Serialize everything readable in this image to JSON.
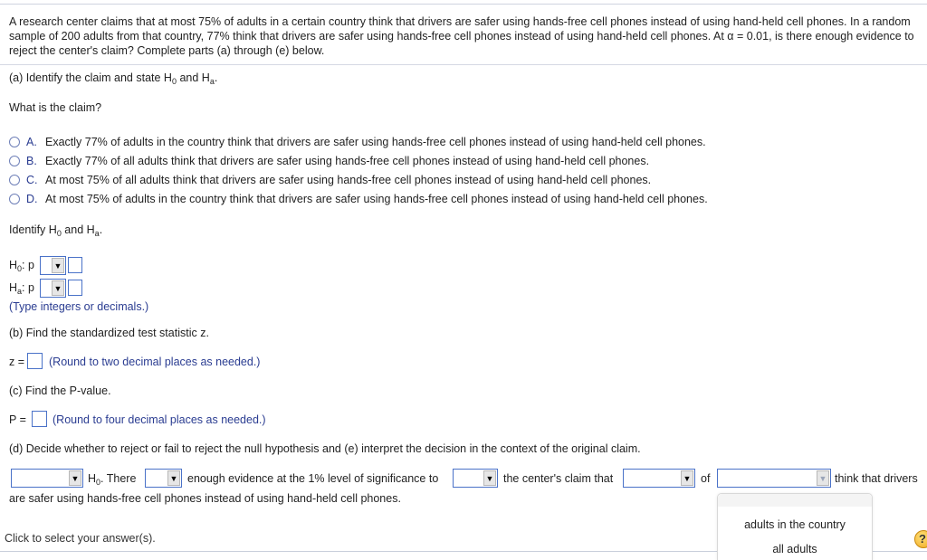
{
  "question": {
    "text": "A research center claims that at most 75% of adults in a certain country think that drivers are safer using hands-free cell phones instead of using hand-held cell phones. In a random sample of 200 adults from that country, 77% think that drivers are safer using hands-free cell phones instead of using hand-held cell phones. At α = 0.01, is there enough evidence to reject the center's claim? Complete parts (a) through (e) below."
  },
  "part_a": {
    "heading_prefix": "(a) Identify the claim and state H",
    "heading_sub0": "0",
    "heading_mid": " and H",
    "heading_suba": "a",
    "heading_end": ".",
    "claim_question": "What is the claim?",
    "options": [
      {
        "letter": "A.",
        "text": "Exactly 77% of adults in the country think that drivers are safer using hands-free cell phones instead of using hand-held cell phones."
      },
      {
        "letter": "B.",
        "text": "Exactly 77% of all adults think that drivers are safer using hands-free cell phones instead of using hand-held cell phones."
      },
      {
        "letter": "C.",
        "text": "At most 75% of all adults think that drivers are safer using hands-free cell phones instead of using hand-held cell phones."
      },
      {
        "letter": "D.",
        "text": "At most 75% of adults in the country think that drivers are safer using hands-free cell phones instead of using hand-held cell phones."
      }
    ],
    "identify_prefix": "Identify H",
    "identify_sub0": "0",
    "identify_mid": " and H",
    "identify_suba": "a",
    "identify_end": ".",
    "h0_label": "H",
    "h0_sub": "0",
    "h0_suffix": ": p",
    "ha_label": "H",
    "ha_sub": "a",
    "ha_suffix": ": p",
    "hint": "(Type integers or decimals.)"
  },
  "part_b": {
    "heading": "(b) Find the standardized test statistic z.",
    "label": "z =",
    "hint": "(Round to two decimal places as needed.)"
  },
  "part_c": {
    "heading": "(c) Find the P-value.",
    "label": "P =",
    "hint": "(Round to four decimal places as needed.)"
  },
  "part_d": {
    "heading": "(d) Decide whether to reject or fail to reject the null hypothesis and (e) interpret the decision in the context of the original claim.",
    "h_label": "H",
    "h_sub": "0",
    "after_h": ". There",
    "enough": "enough evidence at the 1% level of significance to",
    "center_claim": "the center's claim that",
    "of": "of",
    "think": "think that drivers",
    "continuation": "are safer using hands-free cell phones instead of using hand-held cell phones."
  },
  "dropdown_menu": {
    "items": [
      "adults in the country",
      "all adults"
    ]
  },
  "footer": {
    "status": "Click to select your answer(s).",
    "help_glyph": "?"
  },
  "icons": {
    "arrow": "▼"
  }
}
